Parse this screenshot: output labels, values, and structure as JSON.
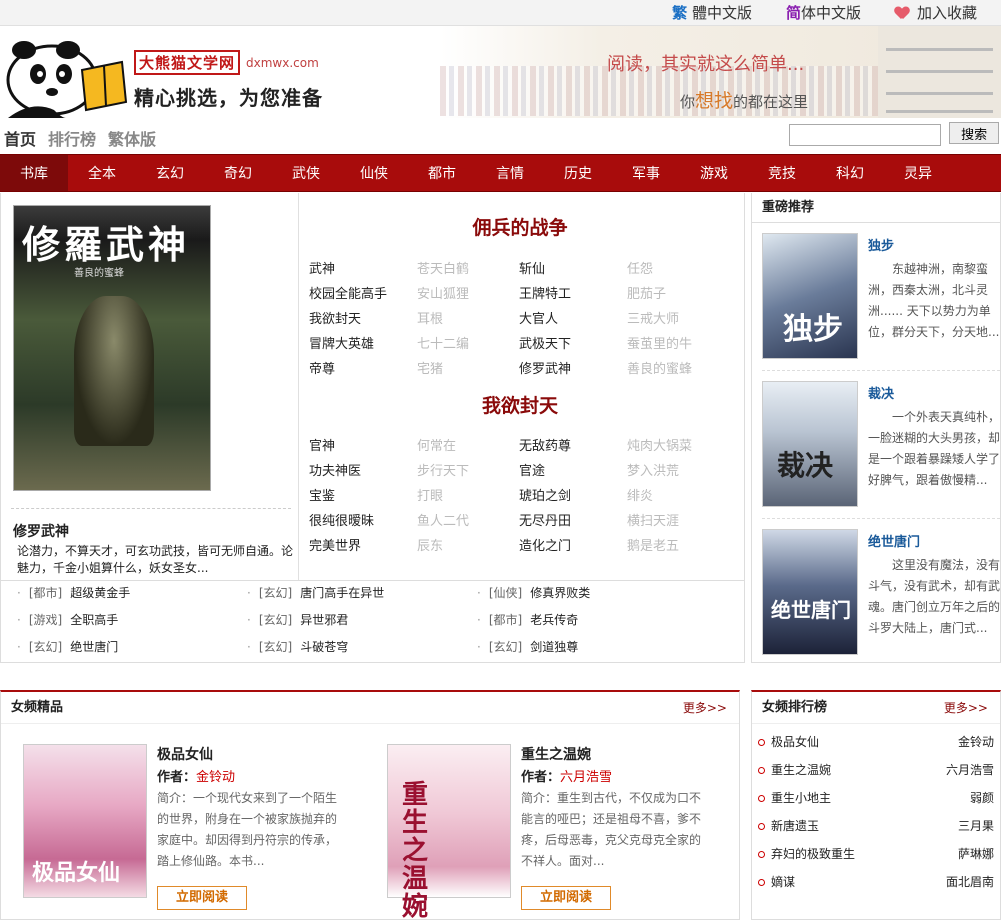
{
  "topbar": {
    "traditional_mark": "繁",
    "traditional_label": "體中文版",
    "simplified_mark": "简",
    "simplified_label": "体中文版",
    "favorite_label": "加入收藏"
  },
  "header": {
    "site_name": "大熊猫文学网",
    "domain": "dxmwx.com",
    "slogan": "精心挑选，为您准备",
    "tagline1": "阅读，其实就这么简单...",
    "tagline2_pre": "你",
    "tagline2_hl": "想找",
    "tagline2_post": "的都在这里"
  },
  "subnav": {
    "items": [
      "首页",
      "排行榜",
      "繁体版"
    ],
    "search_placeholder": "",
    "search_button": "搜索"
  },
  "mainnav": [
    "书库",
    "全本",
    "玄幻",
    "奇幻",
    "武侠",
    "仙侠",
    "都市",
    "言情",
    "历史",
    "军事",
    "游戏",
    "竞技",
    "科幻",
    "灵异"
  ],
  "feature": {
    "cover_title": "修羅武神",
    "cover_author": "善良的蜜蜂",
    "title": "修罗武神",
    "desc": "论潜力，不算天才，可玄功武技，皆可无师自通。论魅力，千金小姐算什么，妖女圣女..."
  },
  "group1": {
    "title": "佣兵的战争",
    "rows": [
      [
        "武神",
        "苍天白鹤",
        "斩仙",
        "任怨"
      ],
      [
        "校园全能高手",
        "安山狐狸",
        "王牌特工",
        "肥茄子"
      ],
      [
        "我欲封天",
        "耳根",
        "大官人",
        "三戒大师"
      ],
      [
        "冒牌大英雄",
        "七十二编",
        "武极天下",
        "蚕茧里的牛"
      ],
      [
        "帝尊",
        "宅猪",
        "修罗武神",
        "善良的蜜蜂"
      ]
    ]
  },
  "group2": {
    "title": "我欲封天",
    "rows": [
      [
        "官神",
        "何常在",
        "无敌药尊",
        "炖肉大锅菜"
      ],
      [
        "功夫神医",
        "步行天下",
        "官途",
        "梦入洪荒"
      ],
      [
        "宝鉴",
        "打眼",
        "琥珀之剑",
        "绯炎"
      ],
      [
        "很纯很暧昧",
        "鱼人二代",
        "无尽丹田",
        "横扫天涯"
      ],
      [
        "完美世界",
        "辰东",
        "造化之门",
        "鹅是老五"
      ]
    ]
  },
  "catlist": [
    {
      "cat": "[都市]",
      "name": "超级黄金手"
    },
    {
      "cat": "[玄幻]",
      "name": "唐门高手在异世"
    },
    {
      "cat": "[仙侠]",
      "name": "修真界败类"
    },
    {
      "cat": "[游戏]",
      "name": "全职高手"
    },
    {
      "cat": "[玄幻]",
      "name": "异世邪君"
    },
    {
      "cat": "[都市]",
      "name": "老兵传奇"
    },
    {
      "cat": "[玄幻]",
      "name": "绝世唐门"
    },
    {
      "cat": "[玄幻]",
      "name": "斗破苍穹"
    },
    {
      "cat": "[玄幻]",
      "name": "剑道独尊"
    }
  ],
  "recommend": {
    "title": "重磅推荐",
    "items": [
      {
        "name": "独步",
        "desc": "东越神洲，南黎蛮洲，西秦太洲，北斗灵洲...... 天下以势力为单位，群分天下，分天地...",
        "cover_text": "独步"
      },
      {
        "name": "裁决",
        "desc": "一个外表天真纯朴，一脸迷糊的大头男孩，却是一个跟着暴躁矮人学了好脾气，跟着傲慢精...",
        "cover_text": "裁决"
      },
      {
        "name": "绝世唐门",
        "desc": "这里没有魔法，没有斗气，没有武术，却有武魂。唐门创立万年之后的斗罗大陆上，唐门式...",
        "cover_text": "绝世唐门"
      }
    ]
  },
  "female": {
    "title": "女频精品",
    "more": "更多>>",
    "author_label": "作者：",
    "read_button": "立即阅读",
    "books": [
      {
        "title": "极品女仙",
        "author": "金铃动",
        "desc": "简介：一个现代女来到了一个陌生的世界，附身在一个被家族抛弃的家庭中。却因得到丹符宗的传承，踏上修仙路。本书...",
        "cover_text": "极品女仙"
      },
      {
        "title": "重生之温婉",
        "author": "六月浩雪",
        "desc": "简介：重生到古代，不仅成为口不能言的哑巴；还是祖母不喜，爹不疼，后母恶毒，克父克母克全家的不祥人。面对...",
        "cover_text": "重生之温婉"
      }
    ]
  },
  "female_rank": {
    "title": "女频排行榜",
    "more": "更多>>",
    "items": [
      {
        "name": "极品女仙",
        "author": "金铃动"
      },
      {
        "name": "重生之温婉",
        "author": "六月浩雪"
      },
      {
        "name": "重生小地主",
        "author": "弱颜"
      },
      {
        "name": "新唐遗玉",
        "author": "三月果"
      },
      {
        "name": "弃妇的极致重生",
        "author": "萨琳娜"
      },
      {
        "name": "嫡谋",
        "author": "面北眉南"
      }
    ]
  }
}
